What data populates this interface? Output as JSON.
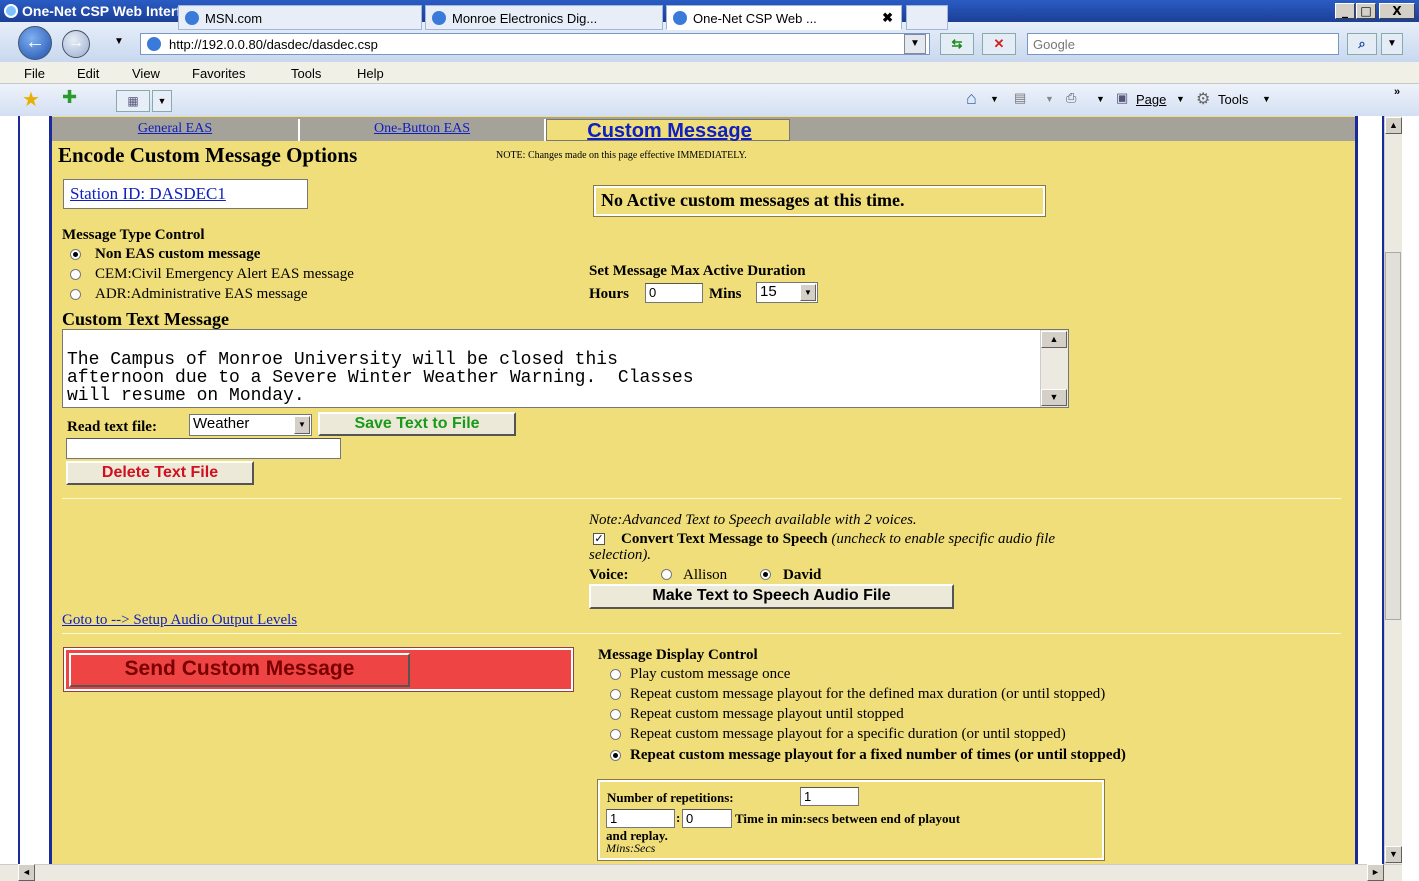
{
  "window": {
    "title": "One-Net CSP Web Interface - Windows Internet Explorer",
    "min": "_",
    "max": "□",
    "close": "X"
  },
  "address": {
    "url": "http://192.0.0.80/dasdec/dasdec.csp",
    "search_placeholder": "Google"
  },
  "menu": [
    "File",
    "Edit",
    "View",
    "Favorites",
    "Tools",
    "Help"
  ],
  "tabs": [
    {
      "label": "MSN.com"
    },
    {
      "label": "Monroe Electronics Dig..."
    },
    {
      "label": "One-Net CSP Web ..."
    }
  ],
  "commandbar": {
    "page": "Page",
    "tools": "Tools"
  },
  "pagetabs": {
    "general": "General EAS",
    "onebutton": "One-Button EAS",
    "custom": "Custom Message"
  },
  "heading": "Encode Custom Message Options",
  "note": "NOTE: Changes made on this page effective IMMEDIATELY.",
  "station_id": "Station ID: DASDEC1",
  "active_status": "No Active custom messages at this time.",
  "message_type": {
    "title": "Message Type Control",
    "options": [
      "Non EAS custom message",
      "CEM:Civil Emergency Alert EAS message",
      "ADR:Administrative EAS message"
    ],
    "selected": 0
  },
  "duration": {
    "title": "Set Message Max Active Duration",
    "hours_label": "Hours",
    "hours": "0",
    "mins_label": "Mins",
    "mins": "15"
  },
  "custom_text": {
    "title": "Custom Text Message",
    "lines": [
      "The Campus of Monroe University will be closed this",
      "afternoon due to a Severe Winter Weather Warning.  Classes",
      "will resume on Monday."
    ]
  },
  "readfile": {
    "label": "Read text file:",
    "selected": "Weather",
    "save_button": "Save Text to File",
    "delete_button": "Delete Text File"
  },
  "tts": {
    "note": "Note:Advanced Text to Speech available with 2 voices.",
    "convert_label": "Convert Text Message to Speech",
    "convert_hint": "(uncheck to enable specific audio file",
    "convert_hint2": "selection).",
    "checked": true,
    "voice_label": "Voice:",
    "voices": [
      "Allison",
      "David"
    ],
    "voice_selected": 1,
    "make_button": "Make Text to Speech Audio File"
  },
  "audio_link": "Goto to --> Setup Audio Output Levels",
  "send_button": "Send Custom Message",
  "display_control": {
    "title": "Message Display Control",
    "options": [
      "Play custom message once",
      "Repeat custom message playout for the defined max duration (or until stopped)",
      "Repeat custom message playout until stopped",
      "Repeat custom message playout for a specific duration (or until stopped)",
      "Repeat custom message playout for a fixed number of times (or until stopped)"
    ],
    "selected": 4
  },
  "repetitions": {
    "label": "Number of repetitions:",
    "value": "1",
    "mins": "1",
    "secs": "0",
    "time_label": "Time in min:secs between end of playout",
    "time_label2": "and replay.",
    "units": "Mins:Secs"
  }
}
